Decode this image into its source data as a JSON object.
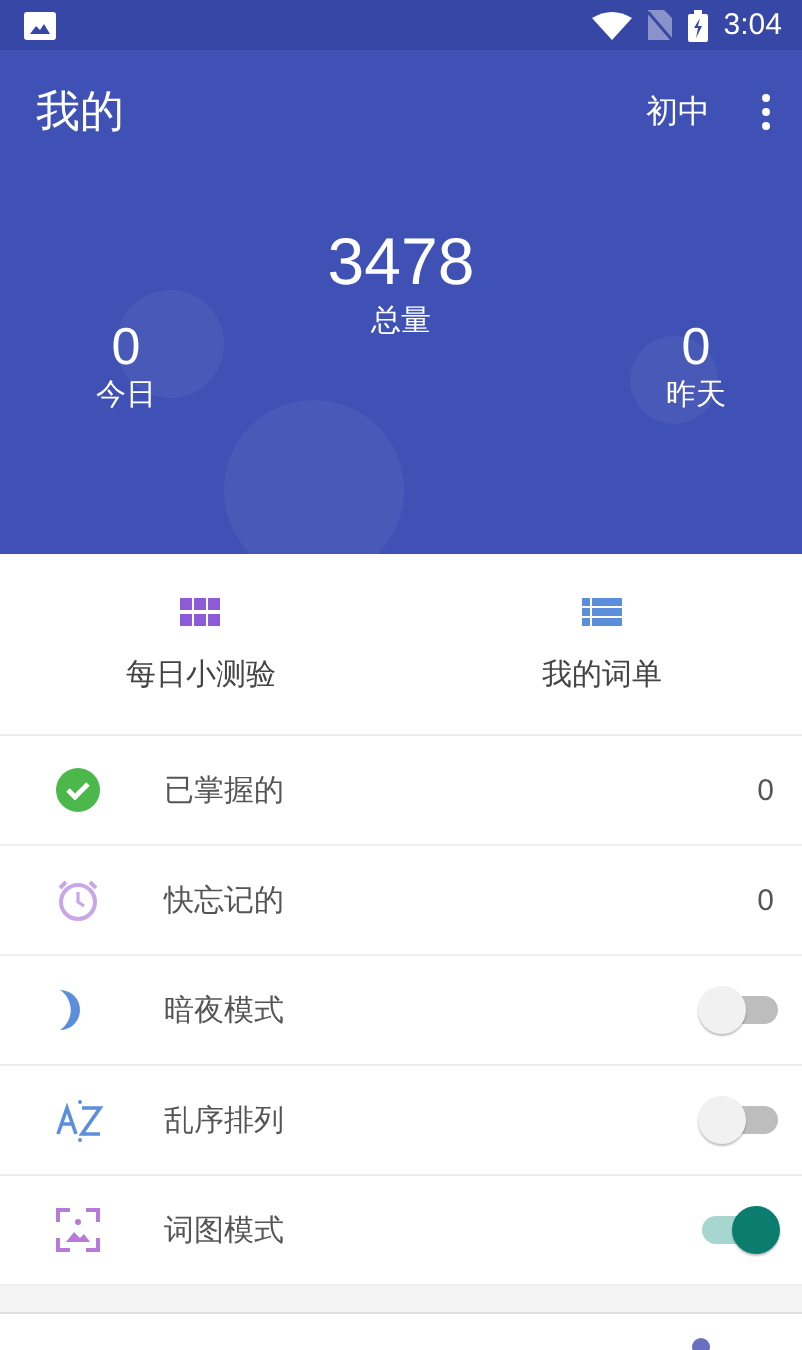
{
  "status_bar": {
    "time": "3:04"
  },
  "header": {
    "title": "我的",
    "level_label": "初中"
  },
  "stats": {
    "total": {
      "value": "3478",
      "label": "总量"
    },
    "today": {
      "value": "0",
      "label": "今日"
    },
    "yesterday": {
      "value": "0",
      "label": "昨天"
    }
  },
  "shortcuts": [
    {
      "label": "每日小测验"
    },
    {
      "label": "我的词单"
    }
  ],
  "rows": [
    {
      "kind": "count",
      "label": "已掌握的",
      "value": "0"
    },
    {
      "kind": "count",
      "label": "快忘记的",
      "value": "0"
    },
    {
      "kind": "toggle",
      "label": "暗夜模式",
      "on": false
    },
    {
      "kind": "toggle",
      "label": "乱序排列",
      "on": false
    },
    {
      "kind": "toggle",
      "label": "词图模式",
      "on": true
    }
  ]
}
